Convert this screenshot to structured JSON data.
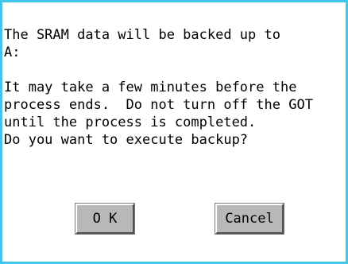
{
  "dialog": {
    "message_lines": [
      "The SRAM data will be backed up to",
      "A:",
      "",
      "It may take a few minutes before the",
      "process ends.  Do not turn off the GOT",
      "until the process is completed.",
      "Do you want to execute backup?"
    ],
    "ok_label": "O K",
    "cancel_label": "Cancel"
  },
  "colors": {
    "border": "#3fc6e8",
    "background": "#ffffff",
    "button": "#b8b8b8"
  }
}
